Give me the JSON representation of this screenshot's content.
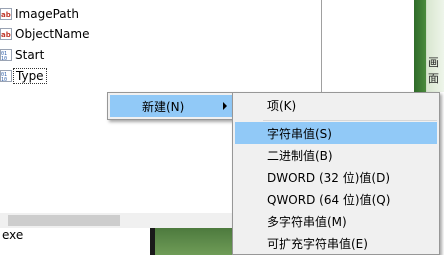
{
  "registry_values": [
    {
      "name": "ImagePath",
      "icon": "string-value-icon"
    },
    {
      "name": "ObjectName",
      "icon": "string-value-icon"
    },
    {
      "name": "Start",
      "icon": "binary-value-icon"
    },
    {
      "name": "Type",
      "icon": "binary-value-icon"
    }
  ],
  "context_menu": {
    "new_label": "新建(N)"
  },
  "submenu": {
    "items": [
      {
        "label": "项(K)"
      },
      {
        "label": "字符串值(S)"
      },
      {
        "label": "二进制值(B)"
      },
      {
        "label": "DWORD (32 位)值(D)"
      },
      {
        "label": "QWORD (64 位)值(Q)"
      },
      {
        "label": "多字符串值(M)"
      },
      {
        "label": "可扩充字符串值(E)"
      }
    ]
  },
  "background": {
    "exe_text": "exe",
    "side_text": "画面"
  },
  "colors": {
    "highlight": "#91c9f7",
    "menu_bg": "#f0f0f0",
    "string_icon": "#c0392b",
    "binary_icon": "#2e5ea8"
  }
}
